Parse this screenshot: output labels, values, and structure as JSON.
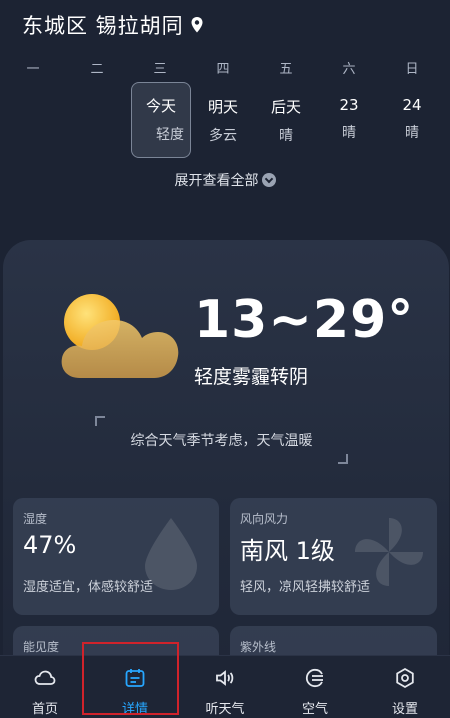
{
  "header": {
    "location": "东城区 锡拉胡同"
  },
  "week": [
    "一",
    "二",
    "三",
    "四",
    "五",
    "六",
    "日"
  ],
  "days": [
    {
      "label": "今天",
      "cond": "轻度",
      "selected": true
    },
    {
      "label": "明天",
      "cond": "多云"
    },
    {
      "label": "后天",
      "cond": "晴"
    },
    {
      "label": "23",
      "cond": "晴"
    },
    {
      "label": "24",
      "cond": "晴"
    }
  ],
  "expand": "展开查看全部",
  "current": {
    "temp": "13~29°",
    "condition": "轻度雾霾转阴",
    "tip": "综合天气季节考虑，天气温暖"
  },
  "tiles": [
    {
      "label": "湿度",
      "value": "47%",
      "desc": "湿度适宜，体感较舒适",
      "icon": "drop-icon"
    },
    {
      "label": "风向风力",
      "value": "南风 1级",
      "desc": "轻风，凉风轻拂较舒适",
      "icon": "pinwheel-icon"
    },
    {
      "label": "能见度",
      "value": "",
      "desc": "",
      "icon": "eye-icon"
    },
    {
      "label": "紫外线",
      "value": "",
      "desc": "",
      "icon": "sun-icon"
    }
  ],
  "nav": [
    {
      "label": "首页",
      "icon": "cloud-icon"
    },
    {
      "label": "详情",
      "icon": "calendar-icon",
      "active": true
    },
    {
      "label": "听天气",
      "icon": "speaker-icon"
    },
    {
      "label": "空气",
      "icon": "air-icon"
    },
    {
      "label": "设置",
      "icon": "gear-icon"
    }
  ],
  "colors": {
    "background": "#1c2333",
    "active": "#27a7ff",
    "highlight": "#d0232b"
  }
}
